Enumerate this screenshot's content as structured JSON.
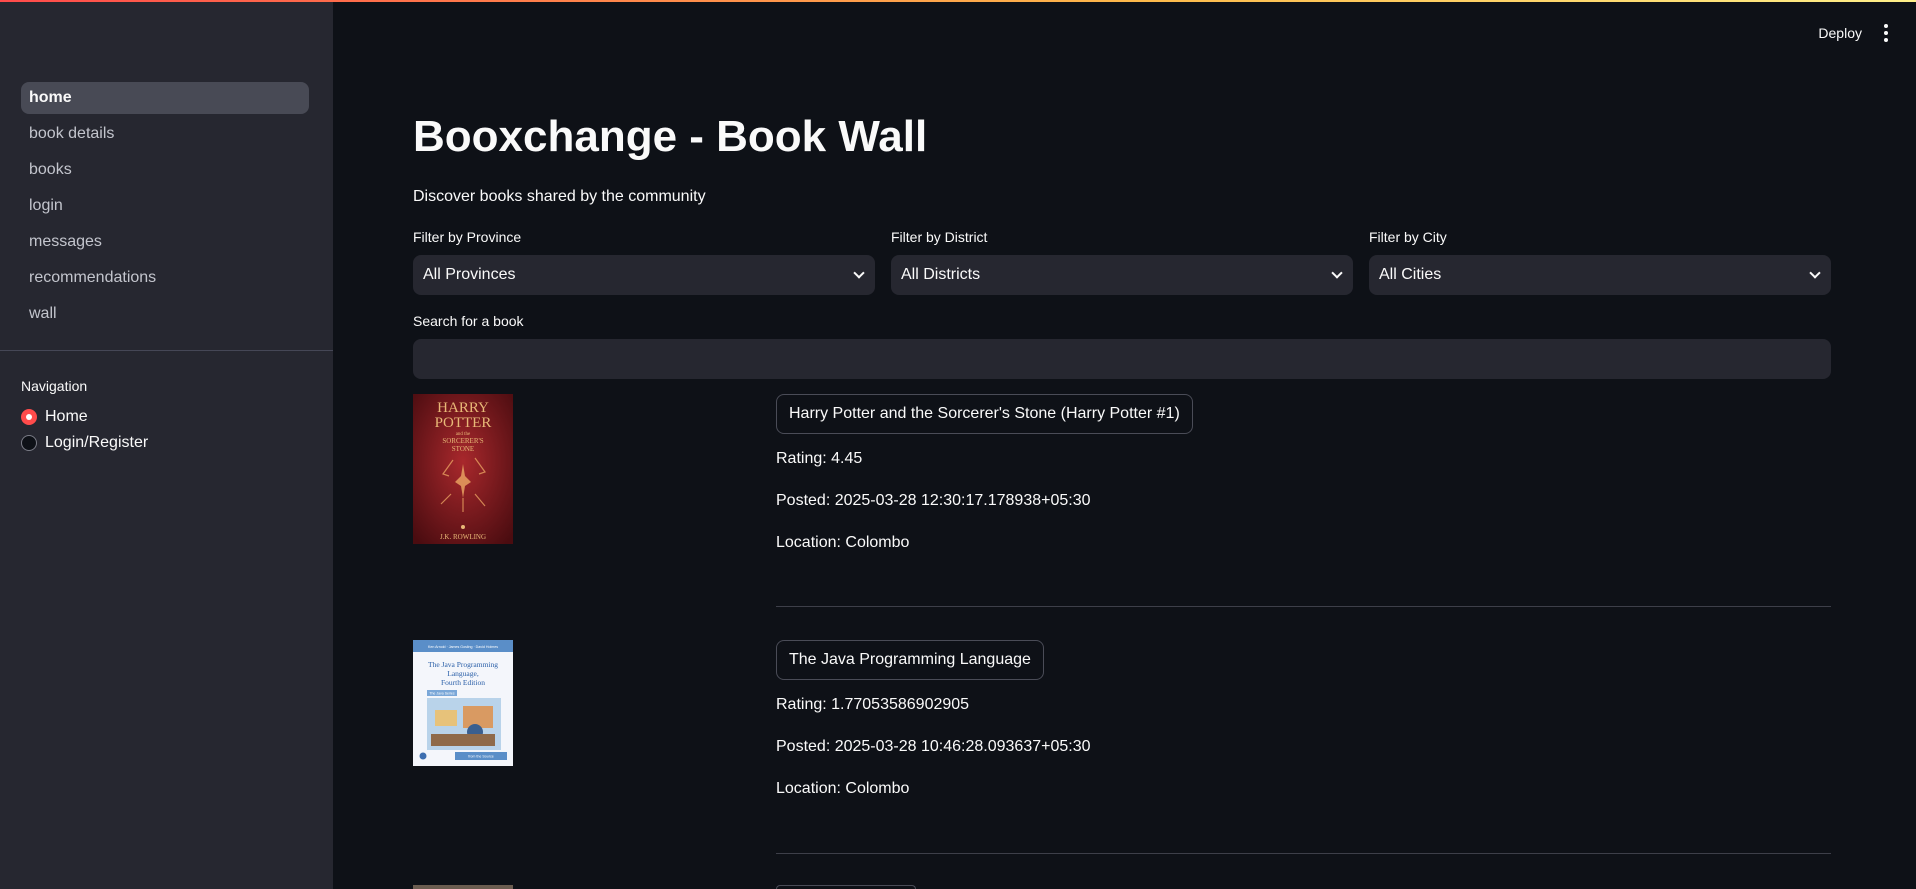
{
  "sidebar": {
    "nav_items": [
      {
        "label": "home",
        "active": true
      },
      {
        "label": "book details"
      },
      {
        "label": "books"
      },
      {
        "label": "login"
      },
      {
        "label": "messages"
      },
      {
        "label": "recommendations"
      },
      {
        "label": "wall"
      }
    ],
    "radio_title": "Navigation",
    "radio_options": [
      {
        "label": "Home",
        "checked": true
      },
      {
        "label": "Login/Register",
        "checked": false
      }
    ]
  },
  "header": {
    "deploy_label": "Deploy"
  },
  "main": {
    "title": "Booxchange - Book Wall",
    "subtitle": "Discover books shared by the community",
    "filters": [
      {
        "label": "Filter by Province",
        "value": "All Provinces"
      },
      {
        "label": "Filter by District",
        "value": "All Districts"
      },
      {
        "label": "Filter by City",
        "value": "All Cities"
      }
    ],
    "search": {
      "label": "Search for a book",
      "value": ""
    },
    "books": [
      {
        "title": "Harry Potter and the Sorcerer's Stone (Harry Potter #1)",
        "rating": "Rating: 4.45",
        "posted": "Posted: 2025-03-28 12:30:17.178938+05:30",
        "location": "Location: Colombo",
        "cover_lines": [
          "HARRY",
          "POTTER",
          "and the",
          "SORCERER'S",
          "STONE",
          "J.K. ROWLING"
        ]
      },
      {
        "title": "The Java Programming Language",
        "rating": "Rating: 1.77053586902905",
        "posted": "Posted: 2025-03-28 10:46:28.093637+05:30",
        "location": "Location: Colombo",
        "cover_lines": [
          "Ken Arnold · James Gosling · David Holmes",
          "The Java Programming",
          "Language,",
          "Fourth Edition",
          "The Java Series",
          "from the Source"
        ]
      }
    ]
  },
  "colors": {
    "accent": "#ff4b4b",
    "background": "#0e1117",
    "sidebar": "#262730"
  }
}
